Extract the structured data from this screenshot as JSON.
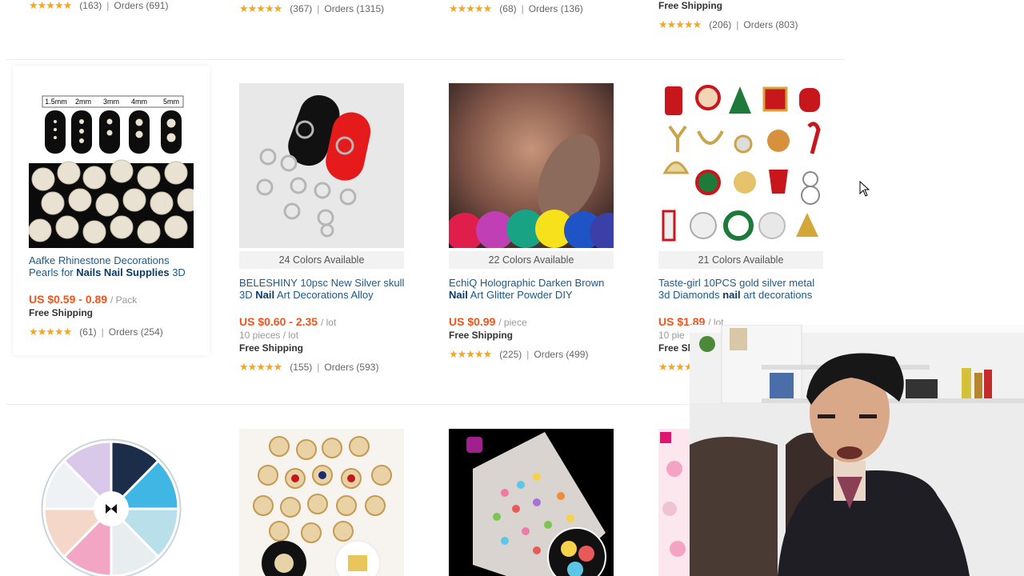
{
  "top_row": [
    {
      "reviews": "(163)",
      "orders": "Orders (691)"
    },
    {
      "reviews": "(367)",
      "orders": "Orders (1315)"
    },
    {
      "reviews": "(68)",
      "orders": "Orders (136)"
    },
    {
      "free_shipping": "Free Shipping",
      "reviews": "(206)",
      "orders": "Orders (803)"
    }
  ],
  "products": [
    {
      "title_pre": "Aafke Rhinestone Decorations Pearls for ",
      "title_bold": "Nails Nail Supplies",
      "title_post": " 3D",
      "price": "US $0.59 - 0.89",
      "unit": "/ Pack",
      "free_shipping": "Free Shipping",
      "reviews": "(61)",
      "orders": "Orders (254)",
      "size_labels": [
        "1.5mm",
        "2mm",
        "3mm",
        "4mm",
        "5mm"
      ]
    },
    {
      "colors": "24 Colors Available",
      "title_pre": "BELESHINY 10psc New Silver skull 3D ",
      "title_bold": "Nail",
      "title_post": " Art Decorations Alloy",
      "price": "US $0.60 - 2.35",
      "unit": "/ lot",
      "lot": "10 pieces / lot",
      "free_shipping": "Free Shipping",
      "reviews": "(155)",
      "orders": "Orders (593)"
    },
    {
      "colors": "22 Colors Available",
      "title_pre": "EchiQ Holographic Darken Brown ",
      "title_bold": "Nail",
      "title_post": " Art Glitter Powder DIY",
      "price": "US $0.99",
      "unit": "/ piece",
      "free_shipping": "Free Shipping",
      "reviews": "(225)",
      "orders": "Orders (499)"
    },
    {
      "colors": "21 Colors Available",
      "title_pre": "Taste-girl 10PCS gold silver metal 3d Diamonds ",
      "title_bold": "nail",
      "title_post": " art decorations",
      "price": "US $1.89",
      "unit": "/ lot",
      "lot": "10 pie",
      "free_shipping": "Free Sh"
    }
  ],
  "colors": {
    "price": "#f2541c",
    "star": "#f5a623",
    "link": "#1a5a8a"
  }
}
